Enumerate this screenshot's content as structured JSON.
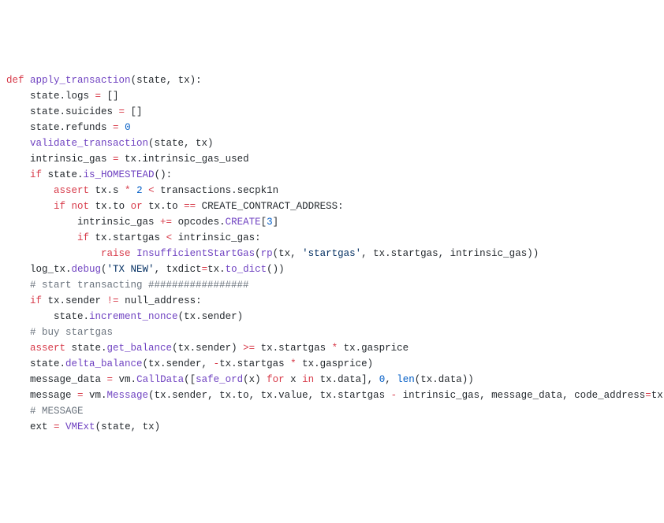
{
  "code": {
    "l1": {
      "def": "def",
      "fn": "apply_transaction",
      "params": "(state, tx):"
    },
    "l2": "    state.logs ",
    "l2op": "=",
    "l2b": " []",
    "l3": "    state.suicides ",
    "l3op": "=",
    "l3b": " []",
    "l4": "    state.refunds ",
    "l4op": "=",
    "l4b": " ",
    "l4num": "0",
    "l5": "    ",
    "l5fn": "validate_transaction",
    "l5b": "(state, tx)",
    "l6": "",
    "l7a": "    intrinsic_gas ",
    "l7op": "=",
    "l7b": " tx.intrinsic_gas_used",
    "l8a": "    ",
    "l8if": "if",
    "l8b": " state.",
    "l8fn": "is_HOMESTEAD",
    "l8c": "():",
    "l9a": "        ",
    "l9kw": "assert",
    "l9b": " tx.s ",
    "l9op": "*",
    "l9c": " ",
    "l9num": "2",
    "l9d": " ",
    "l9op2": "<",
    "l9e": " transactions.secpk1n",
    "l10a": "        ",
    "l10if": "if",
    "l10b": " ",
    "l10not": "not",
    "l10c": " tx.to ",
    "l10or": "or",
    "l10d": " tx.to ",
    "l10eq": "==",
    "l10e": " CREATE_CONTRACT_ADDRESS:",
    "l11a": "            intrinsic_gas ",
    "l11op": "+=",
    "l11b": " opcodes.",
    "l11fn": "CREATE",
    "l11c": "[",
    "l11num": "3",
    "l11d": "]",
    "l12a": "            ",
    "l12if": "if",
    "l12b": " tx.startgas ",
    "l12op": "<",
    "l12c": " intrinsic_gas:",
    "l13a": "                ",
    "l13kw": "raise",
    "l13b": " ",
    "l13fn": "InsufficientStartGas",
    "l13c": "(",
    "l13fn2": "rp",
    "l13d": "(tx, ",
    "l13str": "'startgas'",
    "l13e": ", tx.startgas, intrinsic_gas))",
    "l14": "",
    "l15a": "    log_tx.",
    "l15fn": "debug",
    "l15b": "(",
    "l15str": "'TX NEW'",
    "l15c": ", txdict",
    "l15op": "=",
    "l15d": "tx.",
    "l15fn2": "to_dict",
    "l15e": "())",
    "l16": "",
    "l17": "    # start transacting #################",
    "l18a": "    ",
    "l18if": "if",
    "l18b": " tx.sender ",
    "l18op": "!=",
    "l18c": " null_address:",
    "l19a": "        state.",
    "l19fn": "increment_nonce",
    "l19b": "(tx.sender)",
    "l20": "",
    "l21": "    # buy startgas",
    "l22a": "    ",
    "l22kw": "assert",
    "l22b": " state.",
    "l22fn": "get_balance",
    "l22c": "(tx.sender) ",
    "l22op": ">=",
    "l22d": " tx.startgas ",
    "l22op2": "*",
    "l22e": " tx.gasprice",
    "l23a": "    state.",
    "l23fn": "delta_balance",
    "l23b": "(tx.sender, ",
    "l23op": "-",
    "l23c": "tx.startgas ",
    "l23op2": "*",
    "l23d": " tx.gasprice)",
    "l24": "",
    "l25a": "    message_data ",
    "l25op": "=",
    "l25b": " vm.",
    "l25fn": "CallData",
    "l25c": "([",
    "l25fn2": "safe_ord",
    "l25d": "(x) ",
    "l25for": "for",
    "l25e": " x ",
    "l25in": "in",
    "l25f": " tx.data], ",
    "l25num1": "0",
    "l25g": ", ",
    "l25fn3": "len",
    "l25h": "(tx.data))",
    "l26a": "    message ",
    "l26op": "=",
    "l26b": " vm.",
    "l26fn": "Message",
    "l26c": "(tx.sender, tx.to, tx.value, tx.startgas ",
    "l26op2": "-",
    "l26d": " intrinsic_gas, message_data, code_address",
    "l26op3": "=",
    "l26e": "tx.to)",
    "l27": "",
    "l28": "    # MESSAGE",
    "l29a": "    ext ",
    "l29op": "=",
    "l29b": " ",
    "l29fn": "VMExt",
    "l29c": "(state, tx)"
  }
}
